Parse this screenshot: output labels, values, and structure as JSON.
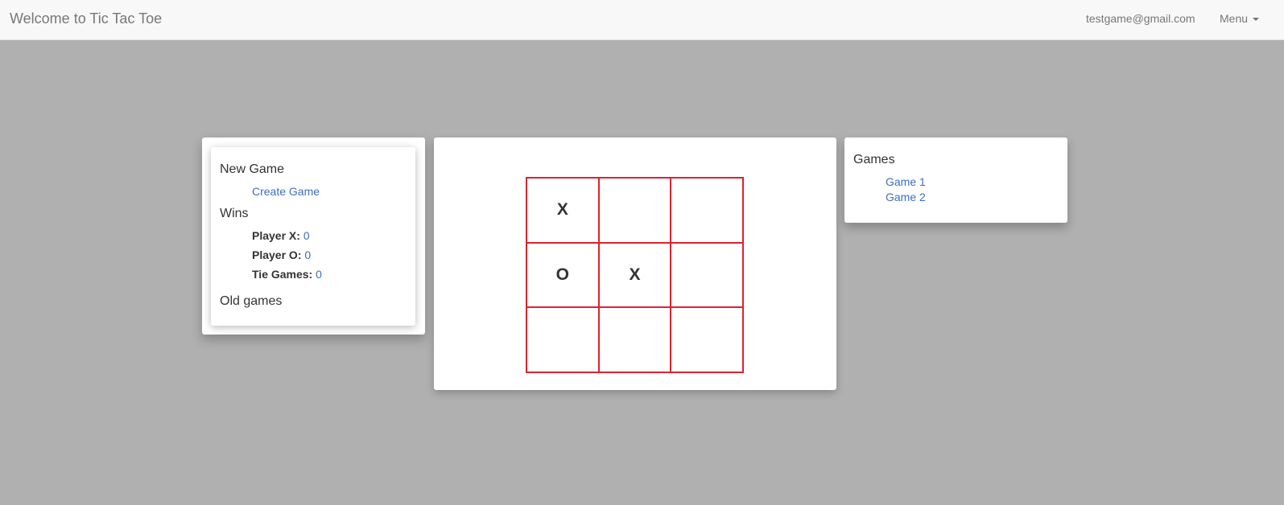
{
  "navbar": {
    "brand": "Welcome to Tic Tac Toe",
    "user_email": "testgame@gmail.com",
    "menu_label": "Menu"
  },
  "left_panel": {
    "new_game_title": "New Game",
    "create_game_link": "Create Game",
    "wins_title": "Wins",
    "stats": [
      {
        "label": "Player X:",
        "value": "0"
      },
      {
        "label": "Player O:",
        "value": "0"
      },
      {
        "label": "Tie Games:",
        "value": "0"
      }
    ],
    "old_games_title": "Old games"
  },
  "board": {
    "cells": [
      "X",
      "",
      "",
      "O",
      "X",
      "",
      "",
      "",
      ""
    ],
    "grid_color": "#e0202e"
  },
  "right_panel": {
    "title": "Games",
    "games": [
      "Game 1",
      "Game 2"
    ]
  },
  "colors": {
    "link": "#3c6ec0",
    "background": "#b0b0b0"
  }
}
